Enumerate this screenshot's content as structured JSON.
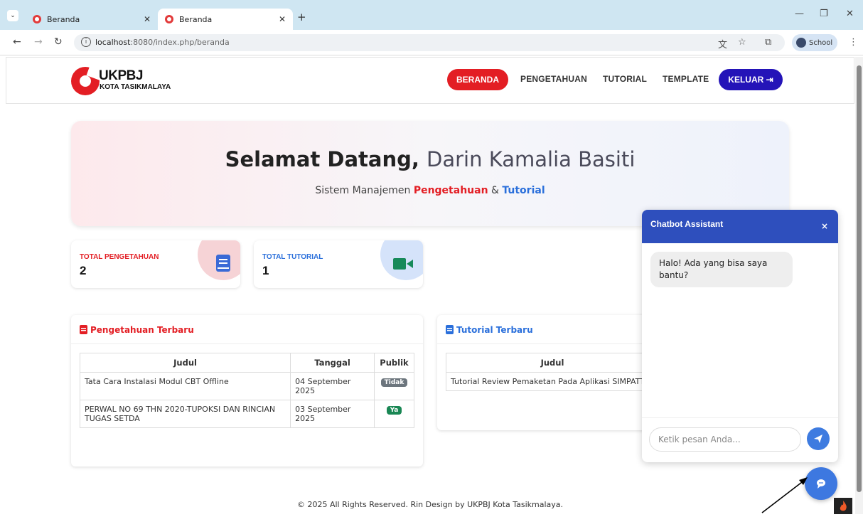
{
  "browser": {
    "tabs": [
      {
        "title": "Beranda"
      },
      {
        "title": "Beranda"
      }
    ],
    "url": {
      "host": "localhost",
      "rest": ":8080/index.php/beranda"
    },
    "profile": "School"
  },
  "nav": {
    "logo_top": "UKPBJ",
    "logo_bottom": "KOTA TASIKMALAYA",
    "links": [
      "BERANDA",
      "PENGETAHUAN",
      "TUTORIAL",
      "TEMPLATE"
    ],
    "logout": "KELUAR",
    "active": "BERANDA"
  },
  "hero": {
    "greeting": "Selamat Datang,",
    "name": "Darin Kamalia Basiti",
    "sub_prefix": "Sistem Manajemen",
    "sub_k1": "Pengetahuan",
    "sub_amp": "&",
    "sub_k2": "Tutorial"
  },
  "stats": [
    {
      "label": "TOTAL PENGETAHUAN",
      "value": "2",
      "color": "#e31e24",
      "circle": "#f6d3d6",
      "icon": "book-icon"
    },
    {
      "label": "TOTAL TUTORIAL",
      "value": "1",
      "color": "#2a6fdb",
      "circle": "#d5e3fa",
      "icon": "video-camera-icon"
    }
  ],
  "pengetahuan": {
    "title": "Pengetahuan Terbaru",
    "columns": [
      "Judul",
      "Tanggal",
      "Publik"
    ],
    "rows": [
      {
        "judul": "Tata Cara Instalasi Modul CBT Offline",
        "tanggal": "04 September 2025",
        "publik": "Tidak"
      },
      {
        "judul": "PERWAL NO 69 THN 2020-TUPOKSI DAN RINCIAN TUGAS SETDA",
        "tanggal": "03 September 2025",
        "publik": "Ya"
      }
    ]
  },
  "tutorial": {
    "title": "Tutorial Terbaru",
    "columns": [
      "Judul"
    ],
    "rows": [
      {
        "judul": "Tutorial Review Pemaketan Pada Aplikasi SIMPATTIK"
      }
    ]
  },
  "chat": {
    "title": "Chatbot Assistant",
    "close": "×",
    "message": "Halo! Ada yang bisa saya bantu?",
    "placeholder": "Ketik pesan Anda..."
  },
  "footer": "© 2025 All Rights Reserved. Rin Design by UKPBJ Kota Tasikmalaya.",
  "colors": {
    "red": "#e31e24",
    "blue": "#2a6fdb",
    "navy": "#2414b8",
    "chat_head": "#2e4fbd"
  }
}
